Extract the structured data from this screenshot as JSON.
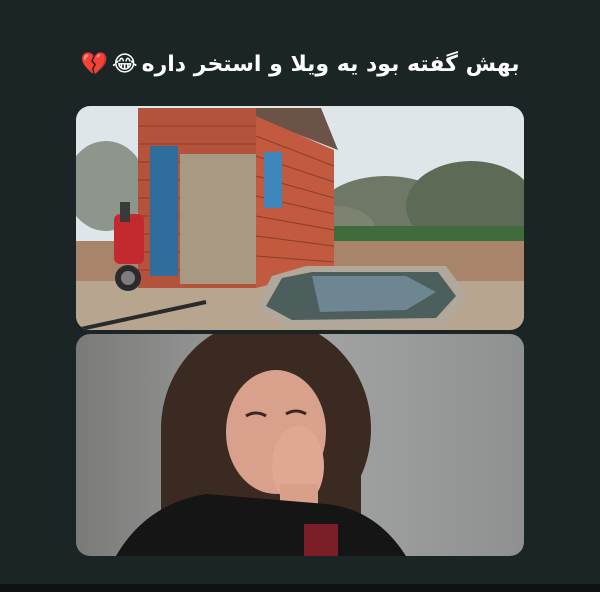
{
  "caption": {
    "text": "بهش گفته بود یه ویلا و استخر داره",
    "emojis": [
      "😂",
      "💔"
    ]
  },
  "images": {
    "top": "brick-hut-with-small-pool-and-motorcycle",
    "bottom": "woman-crying-covering-mouth"
  },
  "colors": {
    "background": "#1b2526",
    "caption": "#ffffff"
  }
}
